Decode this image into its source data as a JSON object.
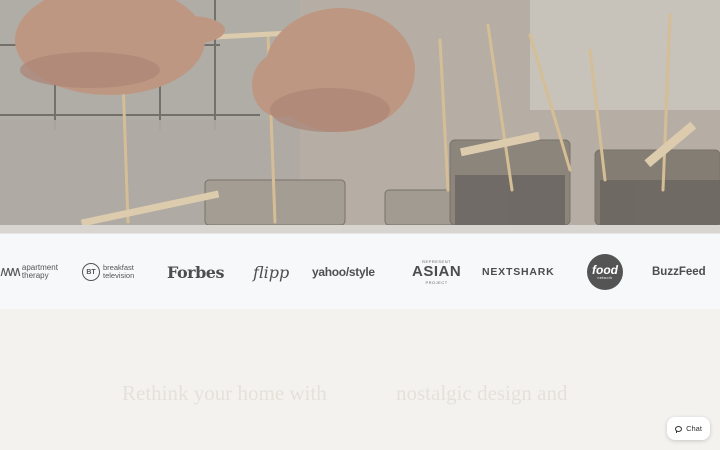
{
  "hero": {
    "image_description_icon": "candle-making-photo"
  },
  "press_logos": {
    "apartment_therapy": {
      "line1": "apartment",
      "line2": "therapy"
    },
    "bt": {
      "badge": "BT",
      "line1": "breakfast",
      "line2": "television"
    },
    "forbes": "Forbes",
    "flipp": "flipp",
    "yahoo_style": "yahoo/style",
    "represent_asian": {
      "top": "REPRESENT",
      "main": "ASIAN",
      "bottom": "PROJECT"
    },
    "nextshark": "NEXTSHARK",
    "food_network": {
      "main": "food",
      "sub": "network"
    },
    "buzzfeed": "BuzzFeed"
  },
  "lower": {
    "eyebrow": "",
    "headline_left": "Rethink your home with",
    "headline_right": "nostalgic design and"
  },
  "chat": {
    "label": "Chat",
    "icon": "chat-bubble-icon"
  },
  "colors": {
    "logo_bar_bg": "#f7f8fa",
    "lower_bg": "#f4f2ee",
    "logo_gray": "#4d4d4d"
  }
}
